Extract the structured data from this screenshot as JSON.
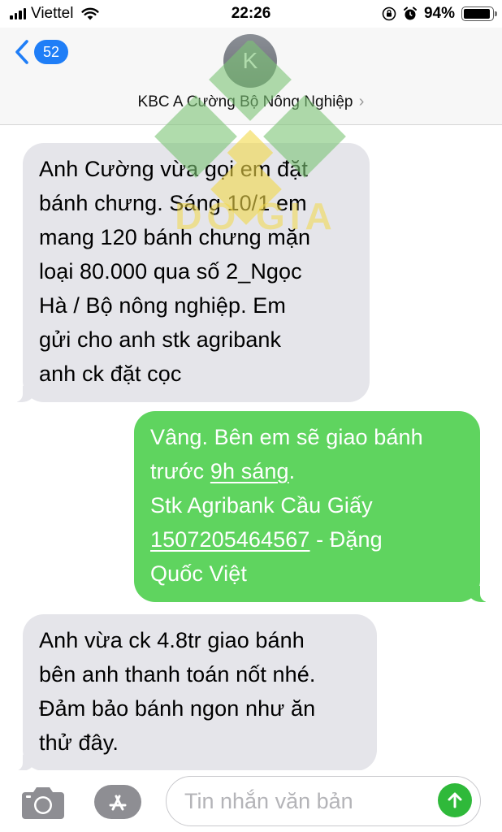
{
  "status_bar": {
    "carrier": "Viettel",
    "time": "22:26",
    "battery_percent": "94%",
    "battery_level": 0.94,
    "signal_bars": 4,
    "icons": [
      "signal-icon",
      "wifi-icon",
      "orientation-lock-icon",
      "alarm-icon",
      "battery-icon"
    ]
  },
  "header": {
    "back_count": "52",
    "avatar_initial": "K",
    "contact_name": "KBC A Cường Bộ Nông Nghiệp",
    "chevron": "›"
  },
  "watermark": {
    "text": "DO GIA",
    "colors": {
      "green": "#7cc576",
      "yellow": "#f2d94a"
    }
  },
  "messages": [
    {
      "direction": "incoming",
      "lines": [
        "Anh Cường vừa gọi em đặt",
        "bánh chưng. Sáng 10/1 em",
        "mang 120 bánh chưng mặn",
        "loại 80.000 qua số 2_Ngọc",
        "Hà / Bộ nông nghiệp. Em",
        "gửi cho anh stk agribank",
        "anh ck đặt cọc"
      ]
    },
    {
      "direction": "outgoing",
      "line1": "Vâng. Bên em sẽ giao bánh",
      "line2_prefix": "trước ",
      "line2_link": "9h sáng",
      "line2_suffix": ".",
      "line3": "Stk Agribank Cầu Giấy",
      "line4_link": "1507205464567",
      "line4_suffix": " - Đặng",
      "line5": "Quốc Việt"
    },
    {
      "direction": "incoming",
      "lines": [
        "Anh vừa ck 4.8tr giao bánh",
        "bên anh thanh toán nốt nhé.",
        "Đảm bảo bánh ngon như ăn",
        "thử đây."
      ]
    }
  ],
  "input_bar": {
    "placeholder": "Tin nhắn văn bản",
    "icons": [
      "camera-icon",
      "app-store-icon",
      "send-arrow-icon"
    ]
  },
  "colors": {
    "incoming_bubble": "#e5e5ea",
    "outgoing_bubble": "#5fd45f",
    "badge": "#1f7ef7",
    "send_button": "#2fb93a"
  }
}
